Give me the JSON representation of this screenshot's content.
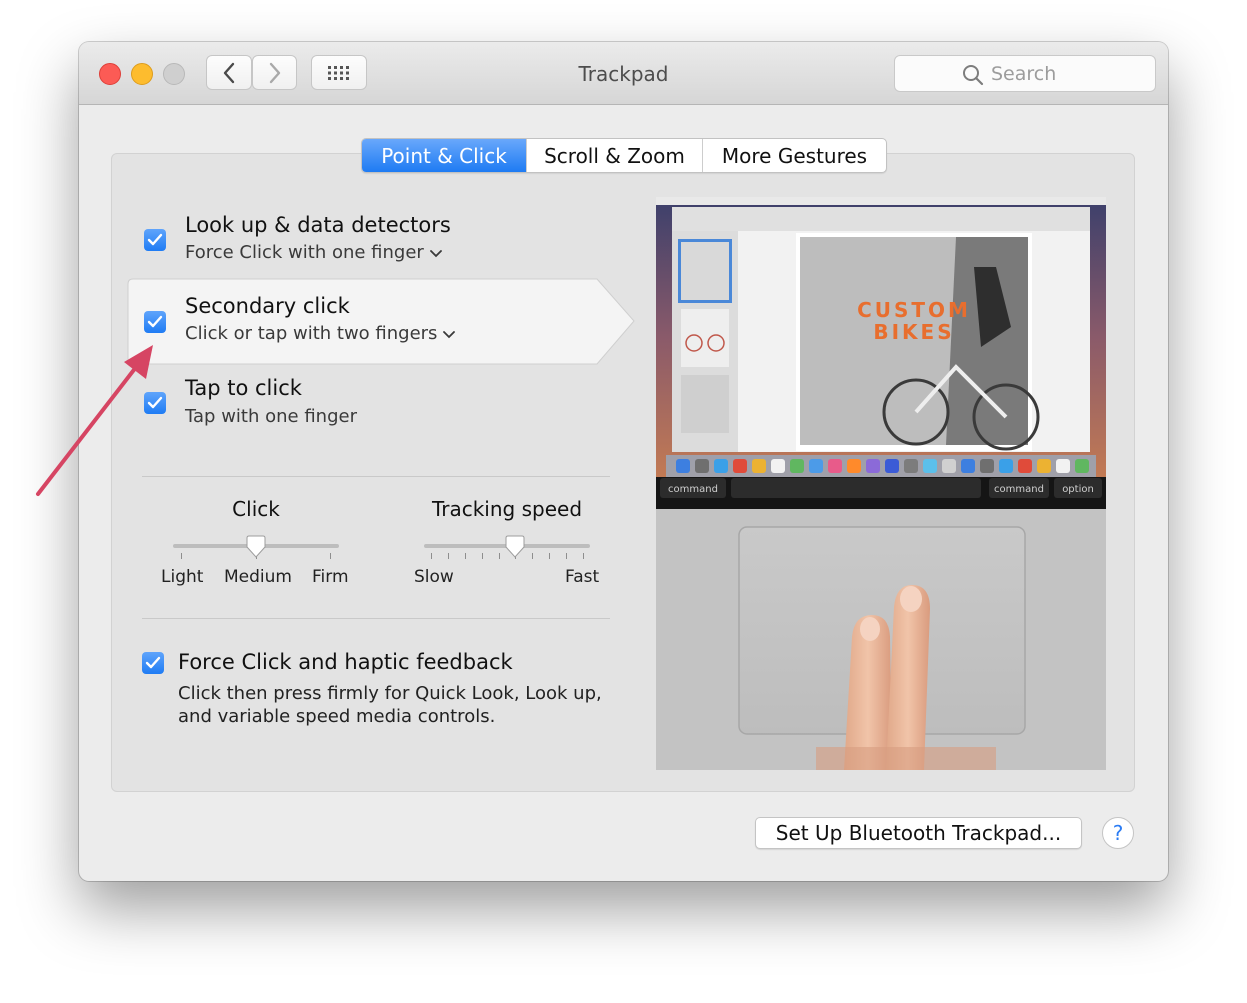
{
  "window": {
    "title": "Trackpad"
  },
  "search": {
    "placeholder": "Search"
  },
  "tabs": [
    {
      "label": "Point & Click",
      "active": true
    },
    {
      "label": "Scroll & Zoom",
      "active": false
    },
    {
      "label": "More Gestures",
      "active": false
    }
  ],
  "options": [
    {
      "title": "Look up & data detectors",
      "subtitle": "Force Click with one finger",
      "checked": true,
      "has_menu": true
    },
    {
      "title": "Secondary click",
      "subtitle": "Click or tap with two fingers",
      "checked": true,
      "has_menu": true,
      "selected": true
    },
    {
      "title": "Tap to click",
      "subtitle": "Tap with one finger",
      "checked": true,
      "has_menu": false
    }
  ],
  "click_slider": {
    "title": "Click",
    "labels": [
      "Light",
      "Medium",
      "Firm"
    ],
    "value": "Medium",
    "position": 0.5
  },
  "tracking_slider": {
    "title": "Tracking speed",
    "min_label": "Slow",
    "max_label": "Fast",
    "position": 0.55,
    "tick_count": 10
  },
  "force_click": {
    "title": "Force Click and haptic feedback",
    "description_line1": "Click then press firmly for Quick Look, Look up,",
    "description_line2": "and variable speed media controls.",
    "checked": true
  },
  "preview": {
    "headline_line1": "CUSTOM",
    "headline_line2": "BIKES",
    "key_command_left": "command",
    "key_command_right": "command",
    "key_option": "option"
  },
  "footer": {
    "bluetooth_button": "Set Up Bluetooth Trackpad...",
    "help_label": "?"
  },
  "colors": {
    "accent": "#1e7bf3",
    "annotation_arrow": "#d64563",
    "close": "#fc5b55",
    "minimize": "#fdbc2e"
  }
}
